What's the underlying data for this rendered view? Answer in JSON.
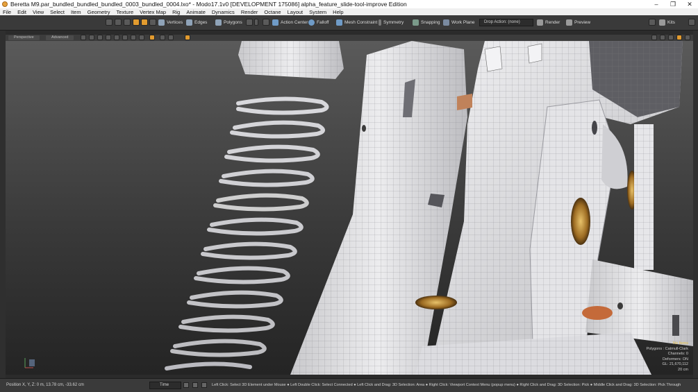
{
  "window": {
    "title": "Beretta M9.par_bundled_bundled_bundled_0003_bundled_0004.lxo* - Modo17.1v0 [DEVELOPMENT 175086]  alpha_feature_slide-tool-improve Edition",
    "controls": [
      "–",
      "❐",
      "✕"
    ]
  },
  "menu": [
    "File",
    "Edit",
    "View",
    "Select",
    "Item",
    "Geometry",
    "Texture",
    "Vertex Map",
    "Rig",
    "Animate",
    "Dynamics",
    "Render",
    "Octane",
    "Layout",
    "System",
    "Help"
  ],
  "toolbar": {
    "vertices": "Vertices",
    "edges": "Edges",
    "polygons": "Polygons",
    "action_center": "Action Center",
    "falloff": "Falloff",
    "mesh_constraint": "Mesh Constraint",
    "symmetry": "Symmetry",
    "snapping": "Snapping",
    "work_plane": "Work Plane",
    "drop_action": "Drop Action: (none)",
    "render": "Render",
    "preview": "Preview",
    "kits": "Kits",
    "accent": "#e29b2f"
  },
  "viewport": {
    "tabs": [
      "Perspective",
      "Advanced"
    ],
    "stats": {
      "no_items": "No Items",
      "polygons": "Polygons : Catmull-Clark",
      "channels": "Channels: 0",
      "deformers": "Deformers: ON",
      "gl": "GL: 21,670,112",
      "scale": "20 cm"
    }
  },
  "status": {
    "position": "Position X, Y, Z:  0 m, 13.78 cm, -33.62 cm",
    "time_label": "Time",
    "hints": "Left Click: Select 3D Element under Mouse ● Left Double Click: Select Connected ● Left Click and Drag: 3D Selection: Area ● Right Click: Viewport Context Menu (popup menu) ● Right Click and Drag: 3D Selection: Pick ● Middle Click and Drag: 3D Selection: Pick Through"
  }
}
